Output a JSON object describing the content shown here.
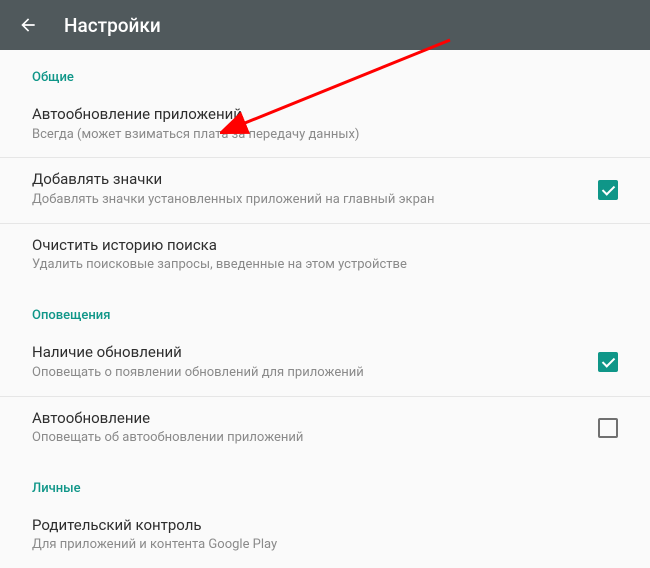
{
  "header": {
    "title": "Настройки"
  },
  "sections": {
    "general": {
      "label": "Общие",
      "auto_update_apps": {
        "title": "Автообновление приложений",
        "sub": "Всегда (может взиматься плата за передачу данных)"
      },
      "add_icons": {
        "title": "Добавлять значки",
        "sub": "Добавлять значки установленных приложений на главный экран",
        "checked": true
      },
      "clear_search": {
        "title": "Очистить историю поиска",
        "sub": "Удалить поисковые запросы, введенные на этом устройстве"
      }
    },
    "notifications": {
      "label": "Оповещения",
      "updates_available": {
        "title": "Наличие обновлений",
        "sub": "Оповещать о появлении обновлений для приложений",
        "checked": true
      },
      "auto_update": {
        "title": "Автообновление",
        "sub": "Оповещать об автообновлении приложений",
        "checked": false
      }
    },
    "personal": {
      "label": "Личные",
      "parental": {
        "title": "Родительский контроль",
        "sub": "Для приложений и контента Google Play"
      }
    }
  },
  "colors": {
    "accent": "#0f9688",
    "appbar": "#50595c"
  }
}
